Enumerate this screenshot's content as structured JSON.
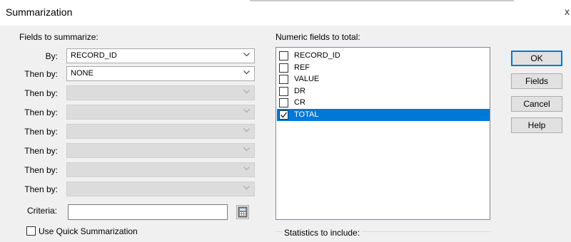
{
  "window": {
    "title": "Summarization",
    "close_glyph": "x"
  },
  "left": {
    "section_label": "Fields to summarize:",
    "rows": [
      {
        "label": "By:",
        "value": "RECORD_ID",
        "enabled": true
      },
      {
        "label": "Then by:",
        "value": "NONE",
        "enabled": true
      },
      {
        "label": "Then by:",
        "value": "",
        "enabled": false
      },
      {
        "label": "Then by:",
        "value": "",
        "enabled": false
      },
      {
        "label": "Then by:",
        "value": "",
        "enabled": false
      },
      {
        "label": "Then by:",
        "value": "",
        "enabled": false
      },
      {
        "label": "Then by:",
        "value": "",
        "enabled": false
      },
      {
        "label": "Then by:",
        "value": "",
        "enabled": false
      }
    ],
    "criteria_label": "Criteria:",
    "criteria_value": "",
    "quick_summarization_label": "Use Quick Summarization",
    "quick_summarization_checked": false
  },
  "numeric": {
    "section_label": "Numeric fields to total:",
    "items": [
      {
        "label": "RECORD_ID",
        "checked": false,
        "selected": false
      },
      {
        "label": "REF",
        "checked": false,
        "selected": false
      },
      {
        "label": "VALUE",
        "checked": false,
        "selected": false
      },
      {
        "label": "DR",
        "checked": false,
        "selected": false
      },
      {
        "label": "CR",
        "checked": false,
        "selected": false
      },
      {
        "label": "TOTAL",
        "checked": true,
        "selected": true
      }
    ]
  },
  "buttons": {
    "ok": "OK",
    "fields": "Fields",
    "cancel": "Cancel",
    "help": "Help"
  },
  "statistics": {
    "label": "Statistics to include:"
  },
  "colors": {
    "selection": "#0078d7",
    "disabled_combo": "#dcdcdc"
  }
}
